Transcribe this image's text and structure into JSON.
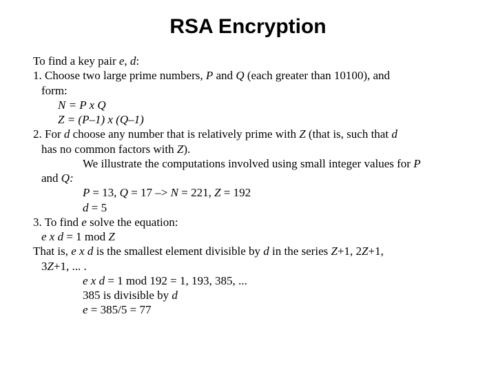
{
  "title": "RSA Encryption",
  "intro": {
    "a": "To find a key pair ",
    "b": "e",
    "c": ", ",
    "d": "d",
    "e": ":"
  },
  "step1": {
    "a": "1. Choose two large prime numbers, ",
    "b": "P",
    "c": " and ",
    "d": "Q",
    "e": " (each greater than 10100), and",
    "f": "form:",
    "g1": "N = P x Q",
    "g2": "Z = (P–1) x (Q–1)"
  },
  "step2": {
    "a": "2. For ",
    "b": "d ",
    "c": "choose any number that is relatively prime with ",
    "d": "Z ",
    "e": "(that is, such that ",
    "f": "d",
    "g": "has no common factors with ",
    "h": "Z",
    "i": ").",
    "j": "We illustrate the computations involved using small integer values for ",
    "k": "P",
    "l": "and ",
    "m": "Q:",
    "n1a": "P ",
    "n1b": "= 13, ",
    "n1c": "Q ",
    "n1d": "= 17 –> ",
    "n1e": "N ",
    "n1f": "= 221, ",
    "n1g": "Z ",
    "n1h": "= 192",
    "n2a": "d ",
    "n2b": "= 5"
  },
  "step3": {
    "a": "3.     To find ",
    "b": "e ",
    "c": "solve the equation:",
    "d1": "e x d ",
    "d2": "= 1 mod ",
    "d3": "Z",
    "e1": "That is, ",
    "e2": "e x d ",
    "e3": "is the smallest element divisible by ",
    "e4": "d ",
    "e5": "in the series ",
    "e6": "Z",
    "e7": "+1, 2",
    "e8": "Z",
    "e9": "+1,",
    "f1": "3",
    "f2": "Z",
    "f3": "+1, ... .",
    "g1": "e x d ",
    "g2": "=  1 mod 192   = 1, 193, 385, ...",
    "h1": "385 is divisible by ",
    "h2": "d",
    "i1": "e ",
    "i2": "= 385/5 = 77"
  }
}
